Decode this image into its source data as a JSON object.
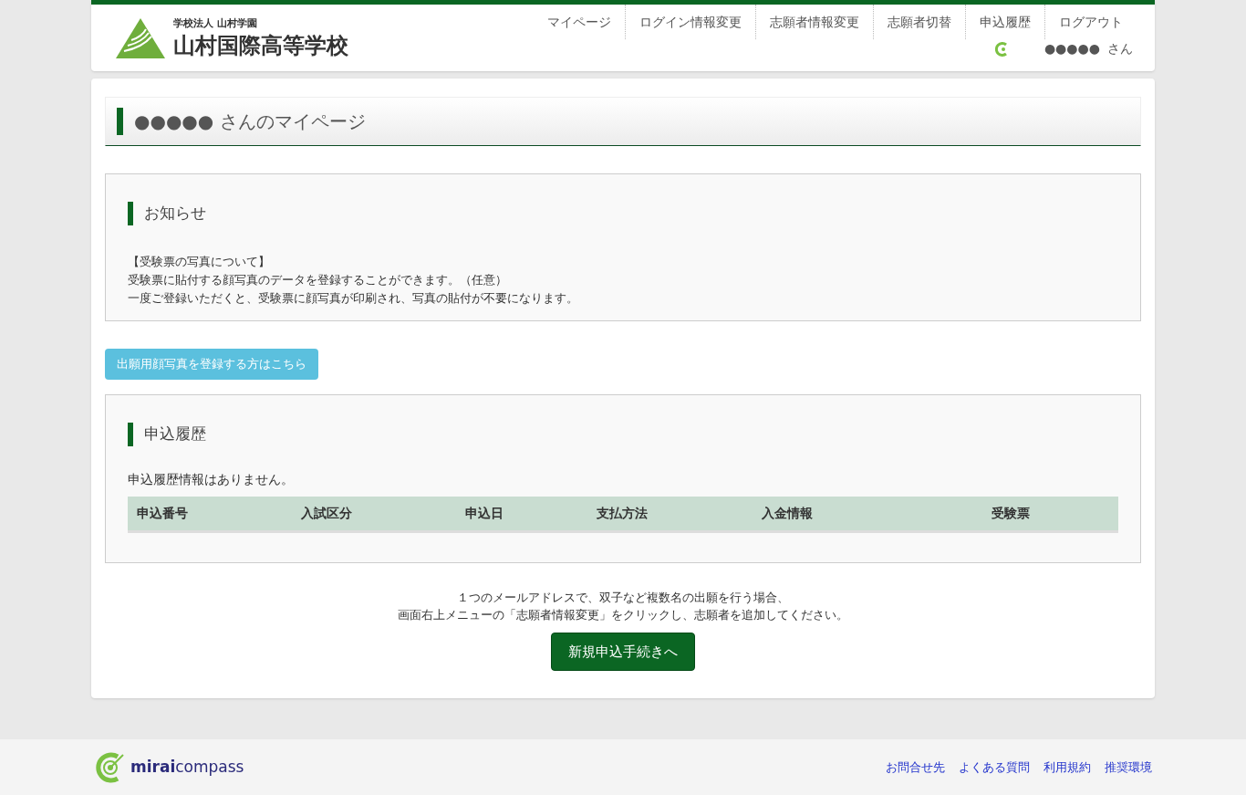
{
  "header": {
    "org": "学校法人 山村学園",
    "school": "山村国際高等学校",
    "nav": [
      "マイページ",
      "ログイン情報変更",
      "志願者情報変更",
      "志願者切替",
      "申込履歴",
      "ログアウト"
    ],
    "user": "●●●●●",
    "user_suffix": "さん"
  },
  "page_title": "●●●●● さんのマイページ",
  "notice": {
    "heading": "お知らせ",
    "lines": [
      "【受験票の写真について】",
      "受験票に貼付する顔写真のデータを登録することができます。（任意）",
      "一度ご登録いただくと、受験票に顔写真が印刷され、写真の貼付が不要になります。"
    ]
  },
  "photo_button": "出願用顔写真を登録する方はこちら",
  "history": {
    "heading": "申込履歴",
    "empty": "申込履歴情報はありません。",
    "columns": [
      "申込番号",
      "入試区分",
      "申込日",
      "支払方法",
      "入金情報",
      "受験票"
    ]
  },
  "note": [
    "１つのメールアドレスで、双子など複数名の出願を行う場合、",
    "画面右上メニューの「志願者情報変更」をクリックし、志願者を追加してください。"
  ],
  "new_button": "新規申込手続きへ",
  "footer": {
    "brand": "**mirai**compass",
    "links": [
      "お問合せ先",
      "よくある質問",
      "利用規約",
      "推奨環境"
    ]
  }
}
